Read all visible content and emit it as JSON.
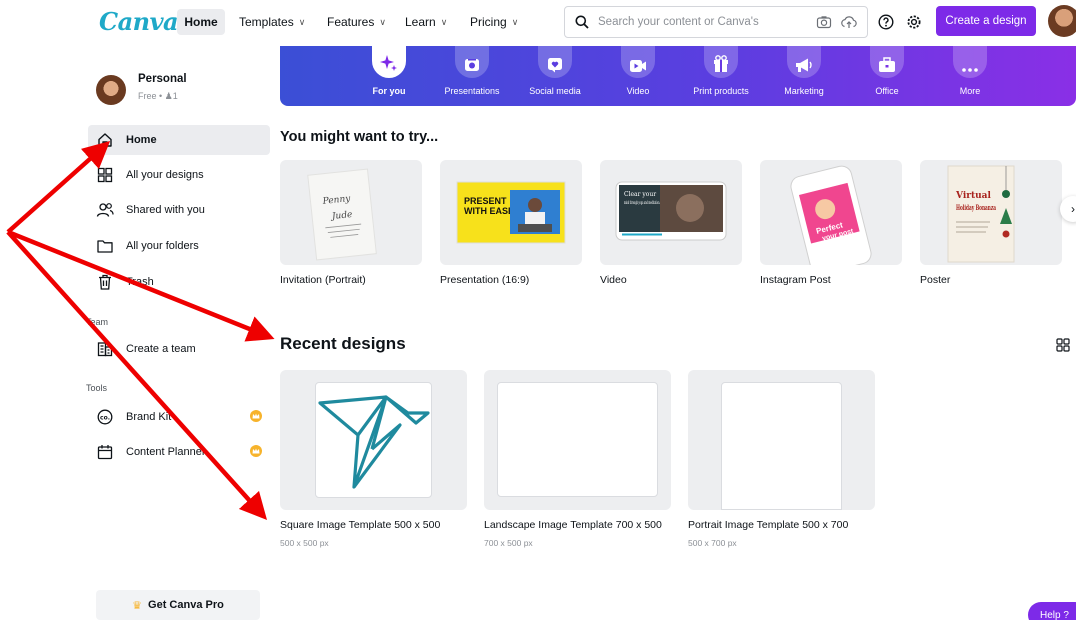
{
  "nav": {
    "logo": "Canva",
    "home": "Home",
    "templates": "Templates",
    "features": "Features",
    "learn": "Learn",
    "pricing": "Pricing",
    "search_placeholder": "Search your content or Canva's",
    "create_button": "Create a design"
  },
  "sidebar": {
    "profile_name": "Personal",
    "profile_sub": "Free • ",
    "profile_members": "1",
    "items": [
      {
        "label": "Home",
        "icon": "home-icon"
      },
      {
        "label": "All your designs",
        "icon": "grid-icon"
      },
      {
        "label": "Shared with you",
        "icon": "people-icon"
      },
      {
        "label": "All your folders",
        "icon": "folder-icon"
      },
      {
        "label": "Trash",
        "icon": "trash-icon"
      }
    ],
    "team_label": "Team",
    "team_item": "Create a team",
    "tools_label": "Tools",
    "tools": [
      {
        "label": "Brand Kit",
        "icon": "brand-kit-icon"
      },
      {
        "label": "Content Planner",
        "icon": "calendar-icon"
      }
    ],
    "get_pro": "Get Canva Pro"
  },
  "categories": [
    {
      "label": "For you",
      "icon": "sparkle-icon"
    },
    {
      "label": "Presentations",
      "icon": "presentation-icon"
    },
    {
      "label": "Social media",
      "icon": "heart-icon"
    },
    {
      "label": "Video",
      "icon": "video-icon"
    },
    {
      "label": "Print products",
      "icon": "gift-icon"
    },
    {
      "label": "Marketing",
      "icon": "megaphone-icon"
    },
    {
      "label": "Office",
      "icon": "briefcase-icon"
    },
    {
      "label": "More",
      "icon": "more-icon"
    }
  ],
  "try_section": {
    "title": "You might want to try...",
    "cards": [
      {
        "label": "Invitation (Portrait)",
        "thumb_line1": "Penny",
        "thumb_line2": "Jude"
      },
      {
        "label": "Presentation (16:9)",
        "thumb_line1": "PRESENT",
        "thumb_line2": "WITH EASE"
      },
      {
        "label": "Video",
        "thumb_line1": "Clear your",
        "thumb_line2": "mind through yoga and meditation."
      },
      {
        "label": "Instagram Post",
        "thumb_line1": "Perfect",
        "thumb_line2": "your post"
      },
      {
        "label": "Poster",
        "thumb_line1": "Virtual",
        "thumb_line2": "Holiday Bonanza"
      }
    ]
  },
  "recent_section": {
    "title": "Recent designs",
    "cards": [
      {
        "title": "Square Image Template 500 x 500",
        "dims": "500 x 500 px"
      },
      {
        "title": "Landscape Image Template 700 x 500",
        "dims": "700 x 500 px"
      },
      {
        "title": "Portrait Image Template 500 x 700",
        "dims": "500 x 700 px"
      }
    ]
  },
  "help": "Help ?",
  "colors": {
    "accent": "#7d2ae8",
    "annotation_arrow": "#ee0000",
    "logo": "#1fa9c8"
  }
}
